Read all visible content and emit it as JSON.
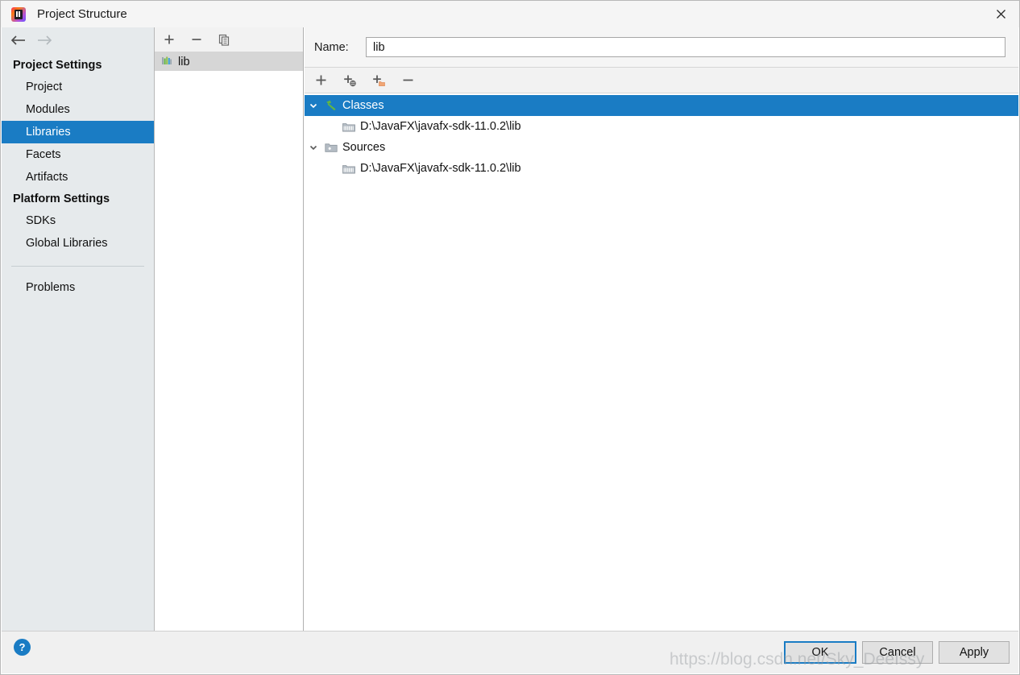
{
  "window": {
    "title": "Project Structure",
    "app_icon": "intellij-idea-icon",
    "close_label": "×"
  },
  "sidebar": {
    "back_label": "←",
    "forward_label": "→",
    "groups": [
      {
        "header": "Project Settings",
        "items": [
          {
            "label": "Project",
            "selected": false
          },
          {
            "label": "Modules",
            "selected": false
          },
          {
            "label": "Libraries",
            "selected": true
          },
          {
            "label": "Facets",
            "selected": false
          },
          {
            "label": "Artifacts",
            "selected": false
          }
        ]
      },
      {
        "header": "Platform Settings",
        "items": [
          {
            "label": "SDKs",
            "selected": false
          },
          {
            "label": "Global Libraries",
            "selected": false
          }
        ]
      }
    ],
    "problems_label": "Problems"
  },
  "library_list": {
    "toolbar": [
      {
        "name": "add-library-button",
        "glyph": "+"
      },
      {
        "name": "remove-library-button",
        "glyph": "−"
      },
      {
        "name": "copy-library-button",
        "glyph": "copy-icon"
      }
    ],
    "items": [
      {
        "label": "lib",
        "icon": "library-icon",
        "selected": true
      }
    ]
  },
  "detail": {
    "name_label": "Name:",
    "name_value": "lib",
    "name_placeholder": "",
    "roots_toolbar": [
      {
        "name": "add-root-button",
        "glyph": "+"
      },
      {
        "name": "add-from-url-button",
        "glyph": "+circle"
      },
      {
        "name": "add-directory-button",
        "glyph": "+folder"
      },
      {
        "name": "remove-root-button",
        "glyph": "−"
      }
    ],
    "tree": [
      {
        "label": "Classes",
        "icon": "hammer-icon",
        "expanded": true,
        "selected": true,
        "level": 0,
        "children": [
          {
            "label": "D:\\JavaFX\\javafx-sdk-11.0.2\\lib",
            "icon": "archive-icon",
            "level": 1
          }
        ]
      },
      {
        "label": "Sources",
        "icon": "folder-icon",
        "expanded": true,
        "selected": false,
        "level": 0,
        "children": [
          {
            "label": "D:\\JavaFX\\javafx-sdk-11.0.2\\lib",
            "icon": "archive-icon",
            "level": 1
          }
        ]
      }
    ]
  },
  "footer": {
    "help_label": "?",
    "ok_label": "OK",
    "cancel_label": "Cancel",
    "apply_label": "Apply"
  },
  "watermark": {
    "text": "https://blog.csdn.net/Sky_DeeIssy"
  },
  "colors": {
    "selection_blue": "#1a7cc4",
    "sidebar_bg": "#e6eaec",
    "footer_bg": "#f0f0f0",
    "toolbar_bg": "#f2f2f2",
    "list_selection_gray": "#d6d6d6"
  }
}
